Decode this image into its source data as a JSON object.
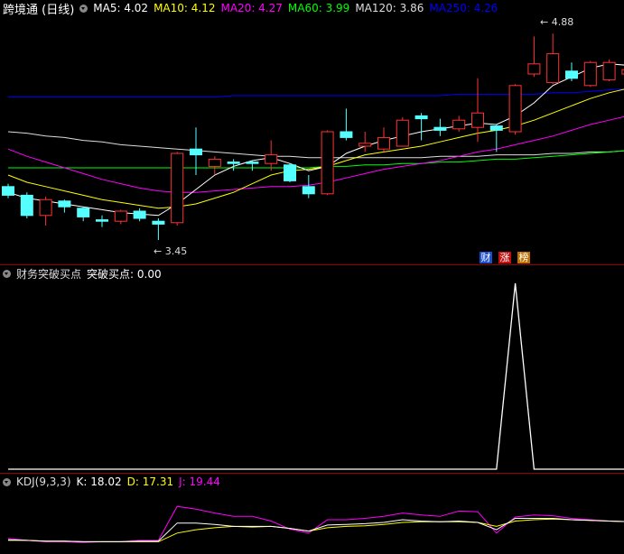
{
  "main_panel": {
    "title": "跨境通 (日线)",
    "indicators": [
      {
        "label": "MA5: 4.02",
        "color": "#ffffff"
      },
      {
        "label": "MA10: 4.12",
        "color": "#ffff00"
      },
      {
        "label": "MA20: 4.27",
        "color": "#ff00ff"
      },
      {
        "label": "MA60: 3.99",
        "color": "#00ff00"
      },
      {
        "label": "MA120: 3.86",
        "color": "#dddddd"
      },
      {
        "label": "MA250: 4.26",
        "color": "#0000ff"
      }
    ],
    "high_label": "4.88",
    "low_label": "3.45",
    "badges": [
      {
        "text": "财",
        "bg": "#1a4fd0"
      },
      {
        "text": "涨",
        "bg": "#c01010"
      },
      {
        "text": "榜",
        "bg": "#c07000"
      }
    ]
  },
  "signal_panel": {
    "title": "财务突破买点",
    "value_label": "突破买点: 0.00"
  },
  "kdj_panel": {
    "title": "KDJ(9,3,3)",
    "k_label": "K: 18.02",
    "d_label": "D: 17.31",
    "j_label": "J: 19.44",
    "colors": {
      "k": "#ffffff",
      "d": "#ffff00",
      "j": "#ff00ff"
    }
  },
  "chart_data": {
    "type": "candlestick",
    "ylim": [
      3.3,
      5.0
    ],
    "candles": [
      {
        "o": 3.82,
        "c": 3.76,
        "h": 3.84,
        "l": 3.74
      },
      {
        "o": 3.76,
        "c": 3.62,
        "h": 3.78,
        "l": 3.6
      },
      {
        "o": 3.62,
        "c": 3.73,
        "h": 3.75,
        "l": 3.55
      },
      {
        "o": 3.72,
        "c": 3.68,
        "h": 3.73,
        "l": 3.64
      },
      {
        "o": 3.67,
        "c": 3.61,
        "h": 3.68,
        "l": 3.58
      },
      {
        "o": 3.59,
        "c": 3.58,
        "h": 3.62,
        "l": 3.54
      },
      {
        "o": 3.58,
        "c": 3.65,
        "h": 3.66,
        "l": 3.56
      },
      {
        "o": 3.65,
        "c": 3.6,
        "h": 3.67,
        "l": 3.58
      },
      {
        "o": 3.58,
        "c": 3.56,
        "h": 3.6,
        "l": 3.45
      },
      {
        "o": 3.57,
        "c": 4.05,
        "h": 4.06,
        "l": 3.55
      },
      {
        "o": 4.08,
        "c": 4.04,
        "h": 4.23,
        "l": 3.9
      },
      {
        "o": 3.96,
        "c": 4.01,
        "h": 4.03,
        "l": 3.9
      },
      {
        "o": 3.99,
        "c": 3.98,
        "h": 4.01,
        "l": 3.93
      },
      {
        "o": 3.99,
        "c": 3.98,
        "h": 4.0,
        "l": 3.93
      },
      {
        "o": 3.98,
        "c": 4.04,
        "h": 4.14,
        "l": 3.93
      },
      {
        "o": 3.97,
        "c": 3.86,
        "h": 3.98,
        "l": 3.85
      },
      {
        "o": 3.82,
        "c": 3.77,
        "h": 3.9,
        "l": 3.74
      },
      {
        "o": 3.77,
        "c": 4.2,
        "h": 4.21,
        "l": 3.76
      },
      {
        "o": 4.2,
        "c": 4.16,
        "h": 4.36,
        "l": 4.14
      },
      {
        "o": 4.1,
        "c": 4.12,
        "h": 4.2,
        "l": 4.06
      },
      {
        "o": 4.08,
        "c": 4.16,
        "h": 4.23,
        "l": 4.06
      },
      {
        "o": 4.1,
        "c": 4.28,
        "h": 4.3,
        "l": 4.1
      },
      {
        "o": 4.31,
        "c": 4.29,
        "h": 4.33,
        "l": 4.14
      },
      {
        "o": 4.23,
        "c": 4.21,
        "h": 4.29,
        "l": 4.17
      },
      {
        "o": 4.22,
        "c": 4.28,
        "h": 4.31,
        "l": 4.2
      },
      {
        "o": 4.23,
        "c": 4.33,
        "h": 4.57,
        "l": 4.13
      },
      {
        "o": 4.24,
        "c": 4.21,
        "h": 4.25,
        "l": 4.06
      },
      {
        "o": 4.2,
        "c": 4.52,
        "h": 4.53,
        "l": 4.18
      },
      {
        "o": 4.6,
        "c": 4.67,
        "h": 4.86,
        "l": 4.58
      },
      {
        "o": 4.54,
        "c": 4.74,
        "h": 4.88,
        "l": 4.53
      },
      {
        "o": 4.62,
        "c": 4.57,
        "h": 4.68,
        "l": 4.55
      },
      {
        "o": 4.52,
        "c": 4.68,
        "h": 4.69,
        "l": 4.51
      },
      {
        "o": 4.56,
        "c": 4.68,
        "h": 4.7,
        "l": 4.55
      },
      {
        "o": 4.6,
        "c": 4.63,
        "h": 4.66,
        "l": 4.52
      }
    ],
    "ma5": [
      3.78,
      3.74,
      3.72,
      3.7,
      3.68,
      3.66,
      3.64,
      3.63,
      3.62,
      3.7,
      3.8,
      3.9,
      3.96,
      4.0,
      4.02,
      3.98,
      3.93,
      3.96,
      4.05,
      4.1,
      4.14,
      4.17,
      4.2,
      4.22,
      4.24,
      4.26,
      4.25,
      4.31,
      4.4,
      4.52,
      4.58,
      4.64,
      4.67,
      4.66
    ],
    "ma10": [
      3.9,
      3.85,
      3.82,
      3.79,
      3.76,
      3.73,
      3.71,
      3.69,
      3.67,
      3.68,
      3.7,
      3.74,
      3.78,
      3.84,
      3.9,
      3.93,
      3.94,
      3.96,
      4.0,
      4.04,
      4.06,
      4.08,
      4.1,
      4.13,
      4.16,
      4.19,
      4.21,
      4.24,
      4.28,
      4.33,
      4.38,
      4.43,
      4.47,
      4.5
    ],
    "ma20": [
      4.08,
      4.03,
      3.99,
      3.95,
      3.91,
      3.87,
      3.84,
      3.81,
      3.79,
      3.78,
      3.78,
      3.79,
      3.8,
      3.81,
      3.82,
      3.82,
      3.83,
      3.85,
      3.88,
      3.91,
      3.94,
      3.96,
      3.98,
      4.0,
      4.03,
      4.06,
      4.08,
      4.11,
      4.14,
      4.17,
      4.21,
      4.25,
      4.28,
      4.31
    ],
    "ma60": [
      3.95,
      3.95,
      3.95,
      3.95,
      3.95,
      3.95,
      3.95,
      3.95,
      3.95,
      3.95,
      3.95,
      3.95,
      3.95,
      3.95,
      3.95,
      3.95,
      3.95,
      3.96,
      3.96,
      3.97,
      3.97,
      3.98,
      3.98,
      3.99,
      3.99,
      4.0,
      4.01,
      4.01,
      4.02,
      4.03,
      4.04,
      4.05,
      4.06,
      4.07
    ],
    "ma120": [
      4.2,
      4.19,
      4.17,
      4.16,
      4.14,
      4.13,
      4.11,
      4.1,
      4.09,
      4.08,
      4.07,
      4.06,
      4.05,
      4.04,
      4.03,
      4.03,
      4.02,
      4.02,
      4.02,
      4.02,
      4.02,
      4.02,
      4.02,
      4.03,
      4.03,
      4.03,
      4.04,
      4.04,
      4.04,
      4.05,
      4.05,
      4.06,
      4.06,
      4.07
    ],
    "ma250": [
      4.44,
      4.44,
      4.44,
      4.44,
      4.44,
      4.44,
      4.44,
      4.44,
      4.44,
      4.44,
      4.44,
      4.44,
      4.45,
      4.45,
      4.45,
      4.45,
      4.45,
      4.45,
      4.45,
      4.45,
      4.45,
      4.45,
      4.45,
      4.45,
      4.46,
      4.46,
      4.46,
      4.46,
      4.46,
      4.47,
      4.47,
      4.48,
      4.49,
      4.5
    ],
    "signal": [
      0,
      0,
      0,
      0,
      0,
      0,
      0,
      0,
      0,
      0,
      0,
      0,
      0,
      0,
      0,
      0,
      0,
      0,
      0,
      0,
      0,
      0,
      0,
      0,
      0,
      0,
      0,
      1,
      0,
      0,
      0,
      0,
      0,
      0
    ],
    "kdj_k": [
      20,
      19,
      18,
      18,
      17,
      17,
      17,
      18,
      18,
      45,
      45,
      43,
      40,
      40,
      40,
      37,
      33,
      42,
      43,
      44,
      46,
      50,
      48,
      47,
      48,
      46,
      35,
      52,
      52,
      52,
      50,
      49,
      48,
      47
    ],
    "kdj_d": [
      19,
      19,
      18,
      18,
      17,
      17,
      17,
      17,
      17,
      30,
      35,
      38,
      40,
      39,
      40,
      37,
      33,
      38,
      40,
      41,
      43,
      46,
      47,
      47,
      47,
      46,
      40,
      48,
      50,
      51,
      50,
      49,
      48,
      47
    ],
    "kdj_j": [
      22,
      19,
      17,
      17,
      16,
      17,
      17,
      19,
      19,
      70,
      66,
      60,
      55,
      55,
      48,
      36,
      30,
      50,
      50,
      52,
      55,
      60,
      57,
      55,
      63,
      62,
      30,
      54,
      57,
      56,
      52,
      50,
      48,
      47
    ],
    "kdj_ylim": [
      0,
      100
    ]
  }
}
